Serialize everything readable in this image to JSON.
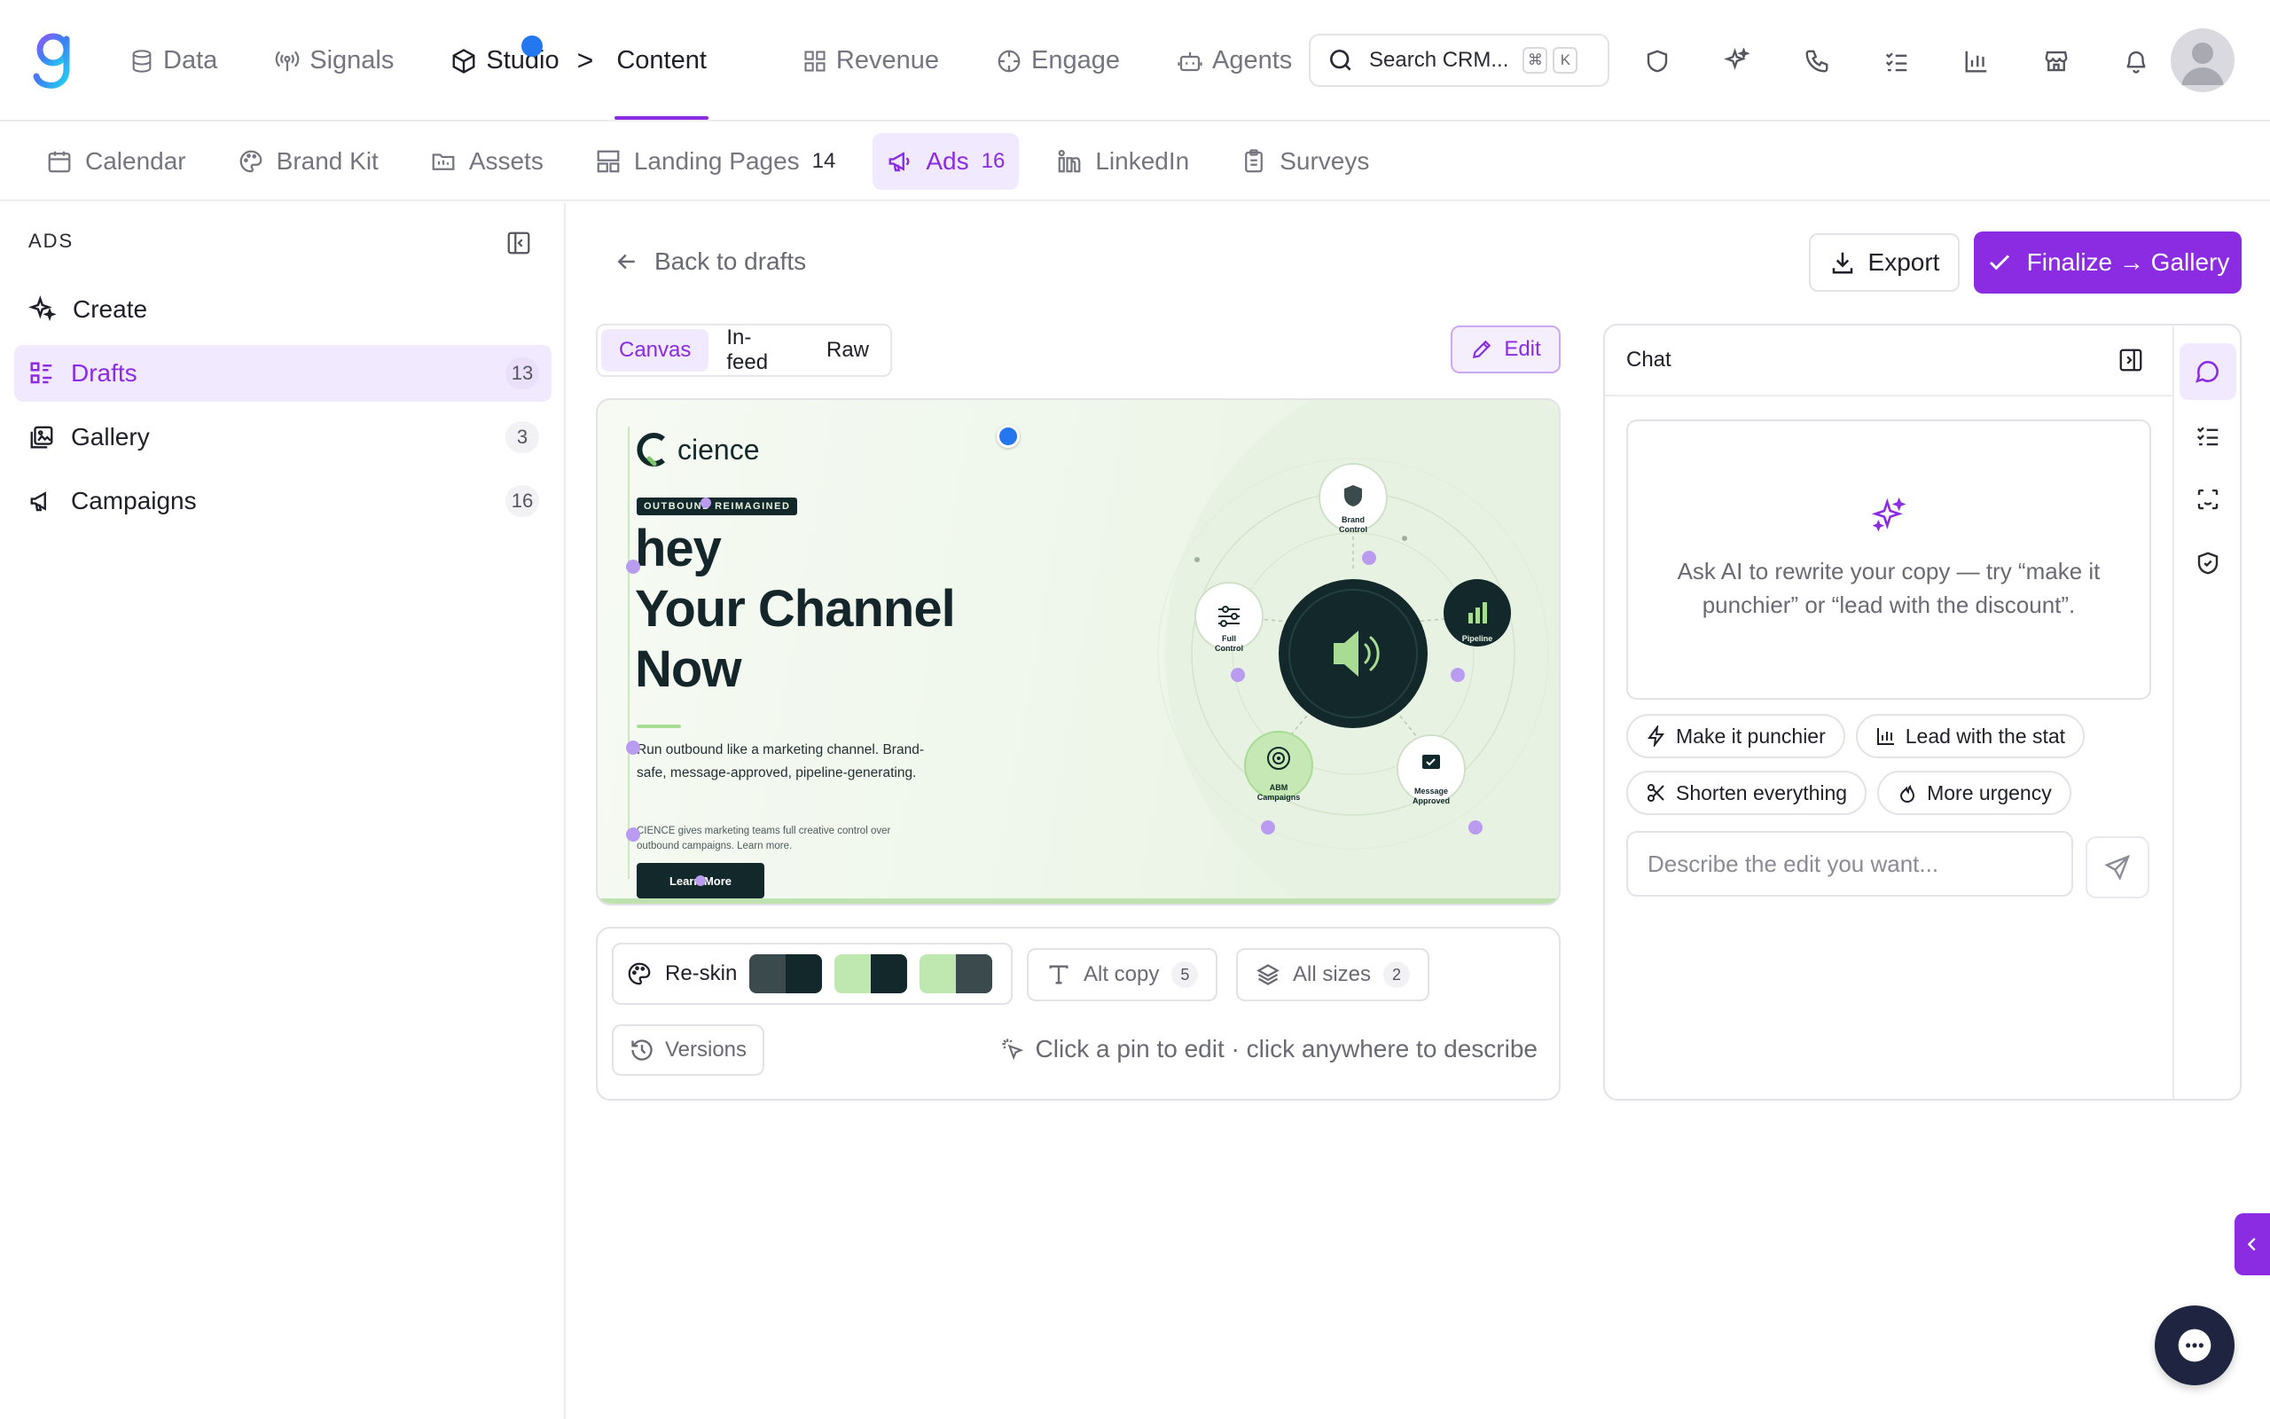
{
  "nav": {
    "items": [
      {
        "label": "Data",
        "icon": "database-icon"
      },
      {
        "label": "Signals",
        "icon": "signal-icon"
      },
      {
        "label": "Studio",
        "icon": "cube-icon"
      },
      {
        "label": "Content"
      },
      {
        "label": "Revenue",
        "icon": "grid-icon"
      },
      {
        "label": "Engage",
        "icon": "target-icon"
      },
      {
        "label": "Agents",
        "icon": "bot-icon"
      }
    ],
    "separator": ">"
  },
  "search": {
    "placeholder": "Search CRM...",
    "kbd1": "⌘",
    "kbd2": "K"
  },
  "subnav": {
    "items": [
      {
        "label": "Calendar",
        "count": ""
      },
      {
        "label": "Brand Kit",
        "count": ""
      },
      {
        "label": "Assets",
        "count": ""
      },
      {
        "label": "Landing Pages",
        "count": "14"
      },
      {
        "label": "Ads",
        "count": "16"
      },
      {
        "label": "LinkedIn",
        "count": ""
      },
      {
        "label": "Surveys",
        "count": ""
      }
    ]
  },
  "sidebar": {
    "heading": "ADS",
    "items": [
      {
        "label": "Create",
        "count": ""
      },
      {
        "label": "Drafts",
        "count": "13"
      },
      {
        "label": "Gallery",
        "count": "3"
      },
      {
        "label": "Campaigns",
        "count": "16"
      }
    ]
  },
  "main": {
    "back_label": "Back to drafts",
    "export_label": "Export",
    "finalize_label": "Finalize → Gallery",
    "view_tabs": [
      "Canvas",
      "In-feed",
      "Raw"
    ],
    "edit_label": "Edit"
  },
  "ad": {
    "brand": "cience",
    "tag": "OUTBOUND REIMAGINED",
    "headline1": "hey",
    "headline2": "Your Channel",
    "headline3": "Now",
    "body": "Run outbound like a marketing channel. Brand-safe, message-approved, pipeline-generating.",
    "small": "CIENCE gives marketing teams full creative control over outbound campaigns. Learn more.",
    "cta": "Learn More",
    "nodes": {
      "brand": [
        "Brand",
        "Control"
      ],
      "full": [
        "Full",
        "Control"
      ],
      "pipeline": [
        "Pipeline"
      ],
      "abm": [
        "ABM",
        "Campaigns"
      ],
      "message": [
        "Message",
        "Approved"
      ]
    },
    "colors": {
      "dark": "#12282a",
      "green": "#a8dc94"
    }
  },
  "tools": {
    "reskin_label": "Re-skin",
    "swatches": [
      [
        "#3b4a4c",
        "#12282a"
      ],
      [
        "#bfe8b0",
        "#12282a"
      ],
      [
        "#bfe8b0",
        "#3b4a4c"
      ]
    ],
    "alt_copy_label": "Alt copy",
    "alt_copy_count": "5",
    "all_sizes_label": "All sizes",
    "all_sizes_count": "2",
    "versions_label": "Versions",
    "hint": "Click a pin to edit · click anywhere to describe"
  },
  "chat": {
    "title": "Chat",
    "empty_text": "Ask AI to rewrite your copy — try “make it punchier” or “lead with the discount”.",
    "chips": [
      "Make it punchier",
      "Lead with the stat",
      "Shorten everything",
      "More urgency"
    ],
    "input_placeholder": "Describe the edit you want..."
  },
  "theme": {
    "accent": "#8b2be2",
    "accent_soft": "#f1e9fd",
    "pin": "#2577f0"
  }
}
